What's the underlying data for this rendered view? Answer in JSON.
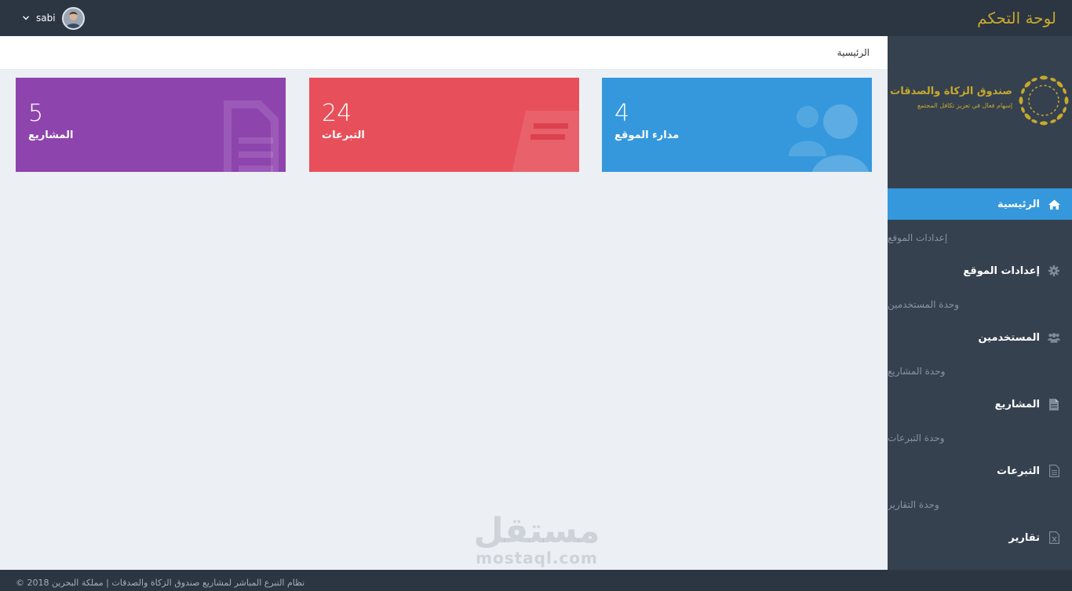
{
  "header": {
    "brand": "لوحة التحكم",
    "user_name": "sabi"
  },
  "logo": {
    "title": "صندوق الزكاة والصدقات",
    "subtitle": "إسهام فعال في تعزيز تكافل المجتمع"
  },
  "breadcrumb": "الرئيسية",
  "sidebar": {
    "items": [
      {
        "type": "link",
        "label": "الرئيسية",
        "icon": "home-icon",
        "active": true
      },
      {
        "type": "heading",
        "label": "إعدادات الموقع"
      },
      {
        "type": "link",
        "label": "إعدادات الموقع",
        "icon": "gear-icon"
      },
      {
        "type": "heading",
        "label": "وحدة المستخدمين"
      },
      {
        "type": "link",
        "label": "المستخدمين",
        "icon": "users-icon"
      },
      {
        "type": "heading",
        "label": "وحدة المشاريع"
      },
      {
        "type": "link",
        "label": "المشاريع",
        "icon": "file-icon"
      },
      {
        "type": "heading",
        "label": "وحدة التبرعات"
      },
      {
        "type": "link",
        "label": "التبرعات",
        "icon": "document-icon"
      },
      {
        "type": "heading",
        "label": "وحدة التقارير"
      },
      {
        "type": "link",
        "label": "تقارير",
        "icon": "excel-file-icon"
      }
    ]
  },
  "stats": [
    {
      "value": "5",
      "label": "المشاريع",
      "color": "#8e44ad",
      "icon": "document-icon"
    },
    {
      "value": "24",
      "label": "التبرعات",
      "color": "#e7505a",
      "icon": "ticket-icon"
    },
    {
      "value": "4",
      "label": "مدارء الموقع",
      "color": "#3598dc",
      "icon": "users-icon"
    }
  ],
  "footer": {
    "copyright": "نظام التبرع المباشر لمشاريع صندوق الزكاة والصدقات | مملكة البحرين 2018 ©"
  },
  "watermark": {
    "arabic": "مستقل",
    "latin": "mostaql.com"
  },
  "colors": {
    "topbar": "#2c3542",
    "sidebar": "#364150",
    "accent": "#3598dc",
    "brand": "#c6a92b"
  }
}
